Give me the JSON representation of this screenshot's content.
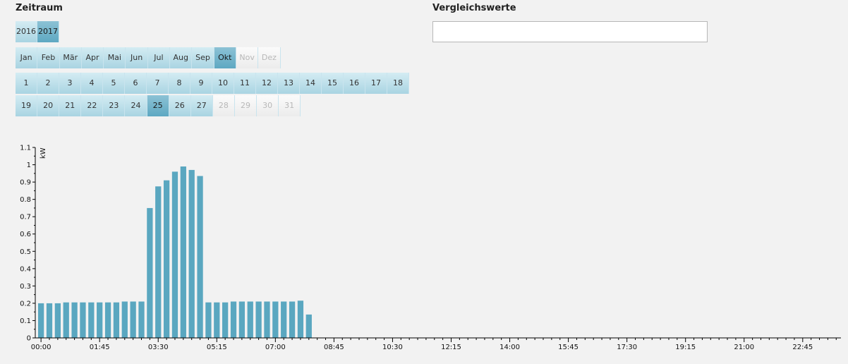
{
  "period": {
    "title": "Zeitraum",
    "years": [
      {
        "label": "2016",
        "state": "normal"
      },
      {
        "label": "2017",
        "state": "active"
      }
    ],
    "months": [
      {
        "label": "Jan",
        "state": "normal"
      },
      {
        "label": "Feb",
        "state": "normal"
      },
      {
        "label": "Mär",
        "state": "normal"
      },
      {
        "label": "Apr",
        "state": "normal"
      },
      {
        "label": "Mai",
        "state": "normal"
      },
      {
        "label": "Jun",
        "state": "normal"
      },
      {
        "label": "Jul",
        "state": "normal"
      },
      {
        "label": "Aug",
        "state": "normal"
      },
      {
        "label": "Sep",
        "state": "normal"
      },
      {
        "label": "Okt",
        "state": "active"
      },
      {
        "label": "Nov",
        "state": "disabled"
      },
      {
        "label": "Dez",
        "state": "disabled"
      }
    ],
    "days_row1": [
      {
        "label": "1",
        "state": "normal"
      },
      {
        "label": "2",
        "state": "normal"
      },
      {
        "label": "3",
        "state": "normal"
      },
      {
        "label": "4",
        "state": "normal"
      },
      {
        "label": "5",
        "state": "normal"
      },
      {
        "label": "6",
        "state": "normal"
      },
      {
        "label": "7",
        "state": "normal"
      },
      {
        "label": "8",
        "state": "normal"
      },
      {
        "label": "9",
        "state": "normal"
      },
      {
        "label": "10",
        "state": "normal"
      },
      {
        "label": "11",
        "state": "normal"
      },
      {
        "label": "12",
        "state": "normal"
      },
      {
        "label": "13",
        "state": "normal"
      },
      {
        "label": "14",
        "state": "normal"
      },
      {
        "label": "15",
        "state": "normal"
      },
      {
        "label": "16",
        "state": "normal"
      },
      {
        "label": "17",
        "state": "normal"
      },
      {
        "label": "18",
        "state": "normal"
      }
    ],
    "days_row2": [
      {
        "label": "19",
        "state": "normal"
      },
      {
        "label": "20",
        "state": "normal"
      },
      {
        "label": "21",
        "state": "normal"
      },
      {
        "label": "22",
        "state": "normal"
      },
      {
        "label": "23",
        "state": "normal"
      },
      {
        "label": "24",
        "state": "normal"
      },
      {
        "label": "25",
        "state": "active"
      },
      {
        "label": "26",
        "state": "normal"
      },
      {
        "label": "27",
        "state": "normal"
      },
      {
        "label": "28",
        "state": "disabled"
      },
      {
        "label": "29",
        "state": "disabled"
      },
      {
        "label": "30",
        "state": "disabled"
      },
      {
        "label": "31",
        "state": "disabled"
      }
    ]
  },
  "compare": {
    "title": "Vergleichswerte",
    "value": ""
  },
  "colors": {
    "bar": "#5aa7c0"
  },
  "chart_data": {
    "type": "bar",
    "ylabel": "kW",
    "ylim": [
      0,
      1.1
    ],
    "yticks": [
      "0",
      "0.1",
      "0.2",
      "0.3",
      "0.4",
      "0.5",
      "0.6",
      "0.7",
      "0.8",
      "0.9",
      "1",
      "1.1"
    ],
    "x_interval_minutes": 15,
    "x_slots": 96,
    "xtick_labels": [
      "00:00",
      "01:45",
      "03:30",
      "05:15",
      "07:00",
      "08:45",
      "10:30",
      "12:15",
      "14:00",
      "15:45",
      "17:30",
      "19:15",
      "21:00",
      "22:45"
    ],
    "xtick_label_every_slots": 7,
    "series": [
      {
        "values": [
          0.2,
          0.2,
          0.2,
          0.205,
          0.205,
          0.205,
          0.205,
          0.205,
          0.205,
          0.205,
          0.21,
          0.21,
          0.21,
          0.75,
          0.875,
          0.91,
          0.96,
          0.99,
          0.97,
          0.935,
          0.205,
          0.205,
          0.205,
          0.21,
          0.21,
          0.21,
          0.21,
          0.21,
          0.21,
          0.21,
          0.21,
          0.215,
          0.135
        ]
      }
    ]
  }
}
